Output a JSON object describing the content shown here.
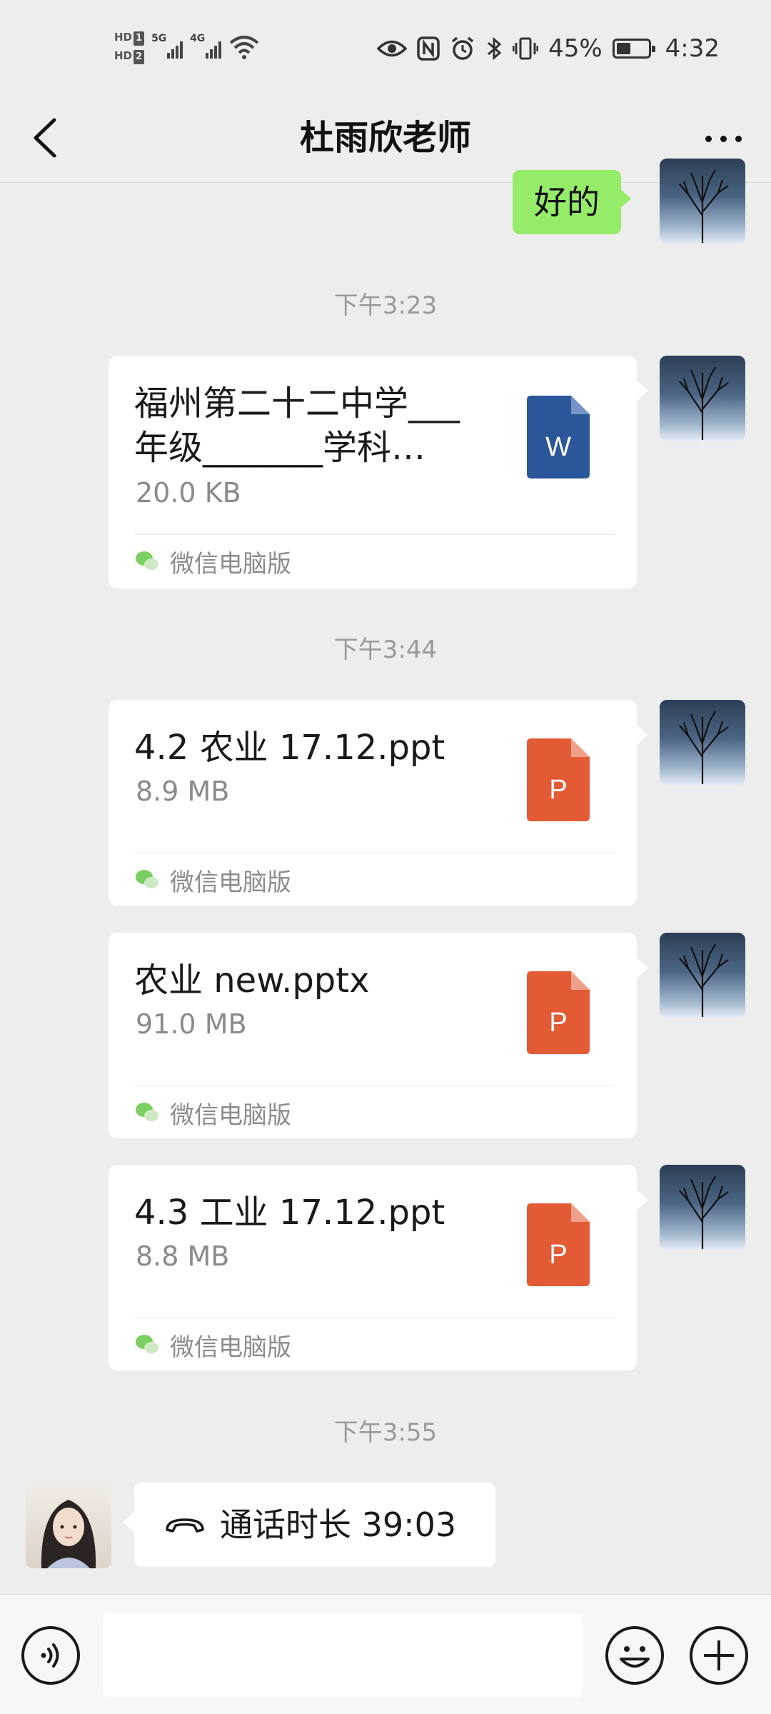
{
  "status_bar": {
    "hd1": "HD",
    "hd1_sim": "1",
    "hd2": "HD",
    "hd2_sim": "2",
    "net1": "5G",
    "net2": "4G",
    "battery_percent_text": "45%",
    "battery_level": 0.45,
    "time": "4:32",
    "icons": [
      "wifi-icon",
      "eye-icon",
      "nfc-icon",
      "alarm-icon",
      "bluetooth-icon",
      "vibrate-icon",
      "battery-icon"
    ]
  },
  "header": {
    "title": "杜雨欣老师",
    "back_icon": "chevron-left-icon",
    "more_icon": "ellipsis-icon"
  },
  "messages": {
    "reply": {
      "text": "好的",
      "sender": "self"
    },
    "timestamps": [
      "下午3:23",
      "下午3:44",
      "下午3:55"
    ],
    "files": [
      {
        "name": "福州第二十二中学___年级_______学科…",
        "size": "20.0 KB",
        "type": "word",
        "icon_letter": "W",
        "source": "微信电脑版",
        "sender": "self"
      },
      {
        "name": "4.2 农业 17.12.ppt",
        "size": "8.9 MB",
        "type": "ppt",
        "icon_letter": "P",
        "source": "微信电脑版",
        "sender": "self"
      },
      {
        "name": "农业 new.pptx",
        "size": "91.0 MB",
        "type": "ppt",
        "icon_letter": "P",
        "source": "微信电脑版",
        "sender": "self"
      },
      {
        "name": "4.3 工业 17.12.ppt",
        "size": "8.8 MB",
        "type": "ppt",
        "icon_letter": "P",
        "source": "微信电脑版",
        "sender": "self"
      }
    ],
    "call": {
      "text": "通话时长 39:03",
      "icon": "phone-hangup-icon",
      "sender": "other"
    }
  },
  "input_bar": {
    "placeholder": "",
    "voice_icon": "voice-icon",
    "emoji_icon": "emoji-icon",
    "plus_icon": "plus-icon"
  },
  "colors": {
    "background": "#ededed",
    "self_bubble": "#95ec69",
    "word_icon": "#2b579a",
    "ppt_icon": "#e35b35",
    "wechat_green": "#07c160"
  }
}
